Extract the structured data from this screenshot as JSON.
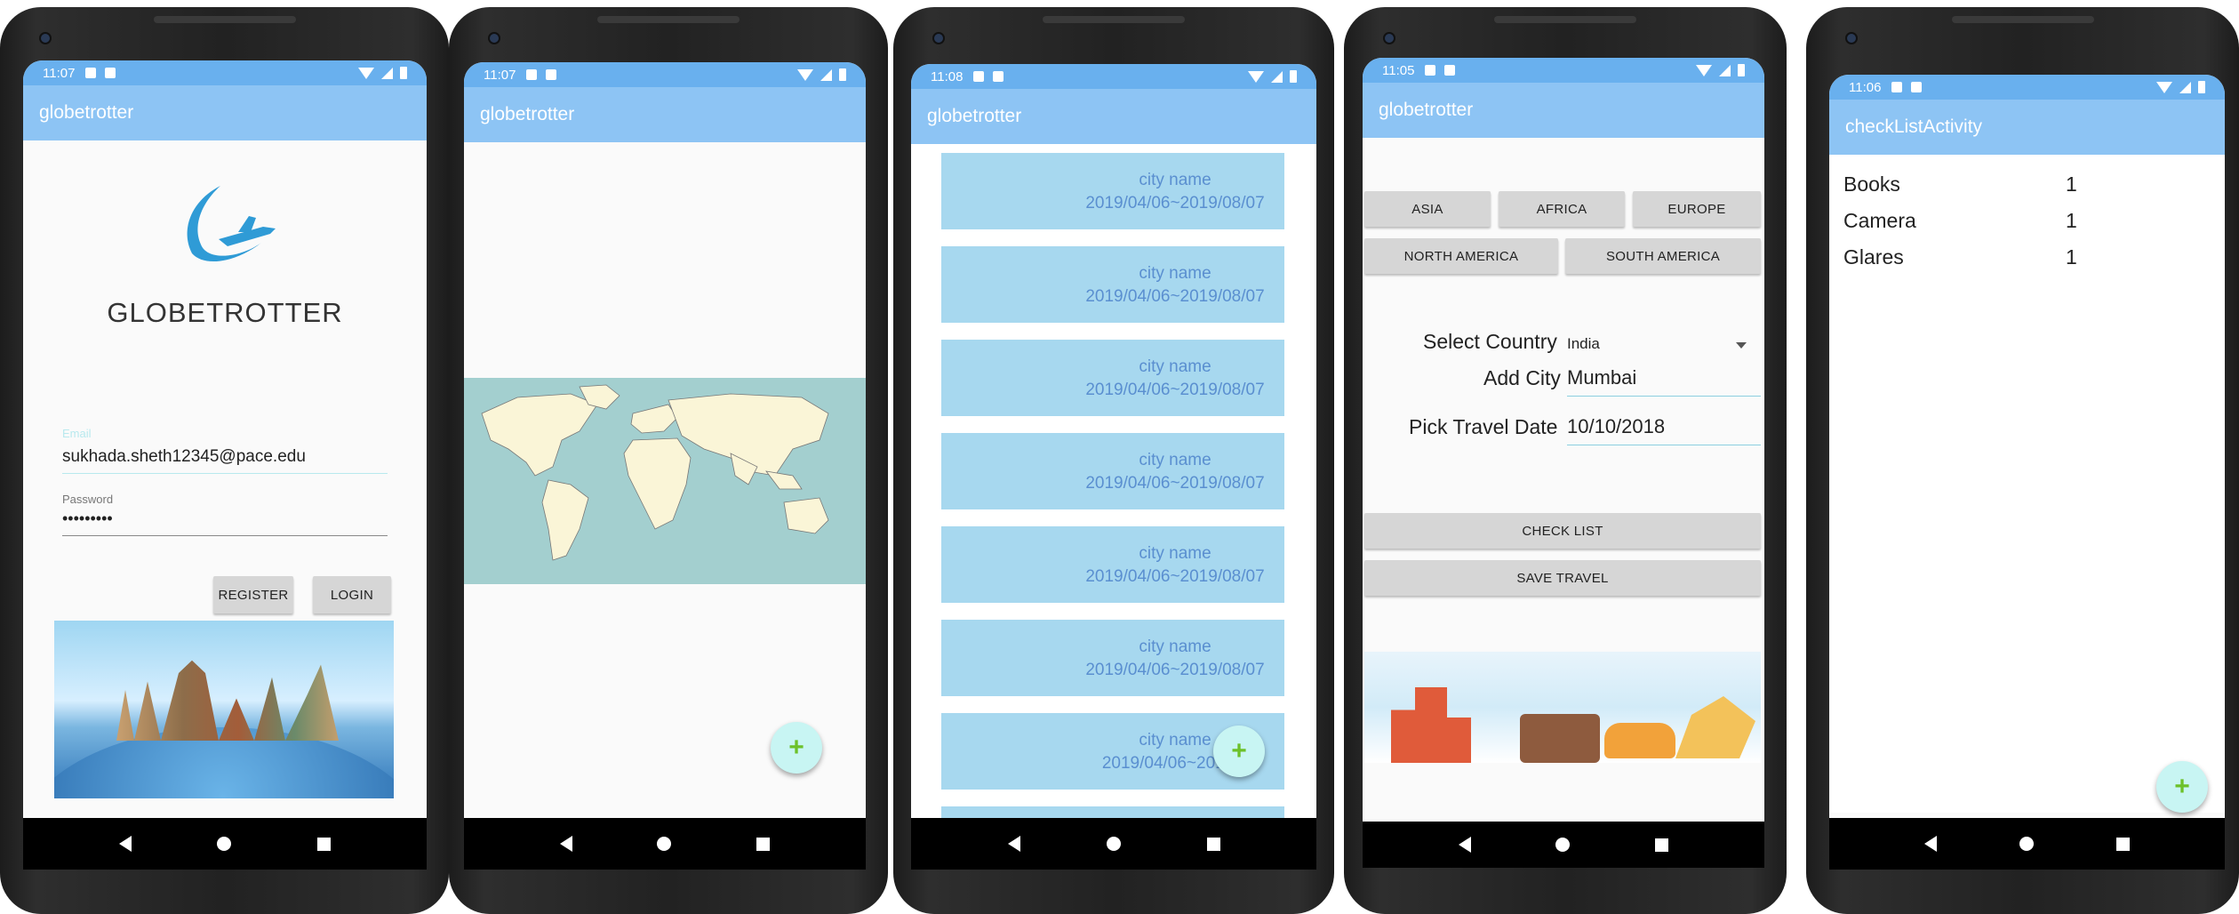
{
  "phones": [
    {
      "status_time": "11:07",
      "app_title": "globetrotter",
      "logo_text": "GLOBETROTTER",
      "email_label": "Email",
      "email_value": "sukhada.sheth12345@pace.edu",
      "password_label": "Password",
      "password_value": "•••••••••",
      "register_label": "REGISTER",
      "login_label": "LOGIN"
    },
    {
      "status_time": "11:07",
      "app_title": "globetrotter"
    },
    {
      "status_time": "11:08",
      "app_title": "globetrotter",
      "trips": [
        {
          "city": "city name",
          "dates": "2019/04/06~2019/08/07"
        },
        {
          "city": "city name",
          "dates": "2019/04/06~2019/08/07"
        },
        {
          "city": "city name",
          "dates": "2019/04/06~2019/08/07"
        },
        {
          "city": "city name",
          "dates": "2019/04/06~2019/08/07"
        },
        {
          "city": "city name",
          "dates": "2019/04/06~2019/08/07"
        },
        {
          "city": "city name",
          "dates": "2019/04/06~2019/08/07"
        },
        {
          "city": "city name",
          "dates": "2019/04/06~2019/0"
        }
      ],
      "fab_label": "+"
    },
    {
      "status_time": "11:05",
      "app_title": "globetrotter",
      "continents": [
        "ASIA",
        "AFRICA",
        "EUROPE",
        "NORTH AMERICA",
        "SOUTH AMERICA"
      ],
      "select_country_label": "Select Country",
      "country_value": "India",
      "add_city_label": "Add City",
      "city_value": "Mumbai",
      "travel_date_label": "Pick Travel Date",
      "travel_date_value": "10/10/2018",
      "checklist_label": "CHECK LIST",
      "save_label": "SAVE TRAVEL"
    },
    {
      "status_time": "11:06",
      "app_title": "checkListActivity",
      "items": [
        {
          "name": "Books",
          "qty": "1"
        },
        {
          "name": "Camera",
          "qty": "1"
        },
        {
          "name": "Glares",
          "qty": "1"
        }
      ],
      "fab_label": "+"
    }
  ],
  "second_fab_label": "+",
  "colors": {
    "status_bar": "#69b0ee",
    "app_bar": "#8dc4f4",
    "card": "#a7d8ef",
    "card_text": "#5a8fd0",
    "fab": "#c8f5f3",
    "fab_plus": "#6cc12a",
    "button": "#d6d6d6"
  }
}
